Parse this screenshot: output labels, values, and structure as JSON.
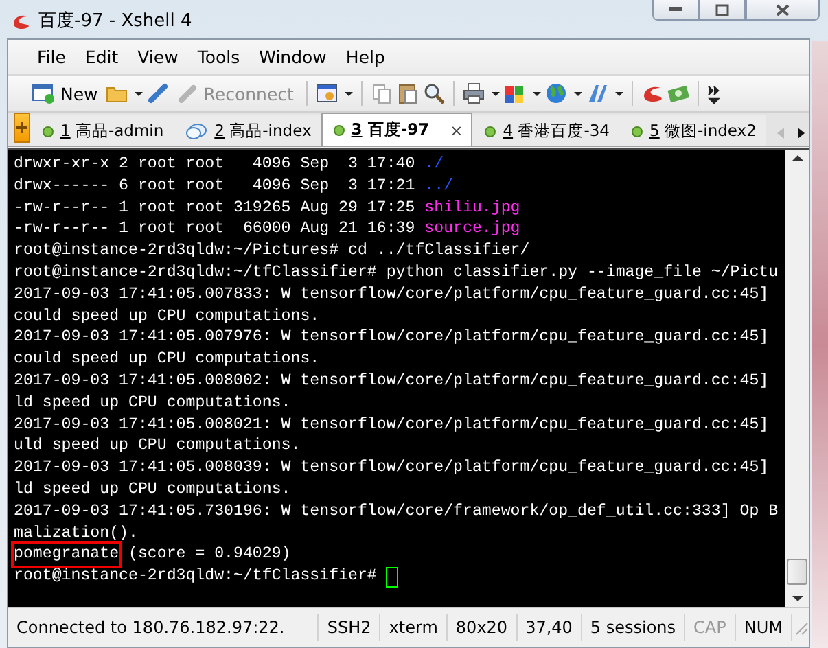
{
  "window": {
    "title": "百度-97 - Xshell 4"
  },
  "menu": [
    "File",
    "Edit",
    "View",
    "Tools",
    "Window",
    "Help"
  ],
  "toolbar": {
    "new": {
      "label": "New",
      "disabled": false
    },
    "reconnect": {
      "label": "Reconnect",
      "disabled": true
    }
  },
  "tabs": [
    {
      "number": "1",
      "label": "高品-admin",
      "kind": "dot",
      "selected": false
    },
    {
      "number": "2",
      "label": "高品-index",
      "kind": "chat",
      "selected": false
    },
    {
      "number": "3",
      "label": "百度-97",
      "kind": "dot",
      "selected": true,
      "close": "×"
    },
    {
      "number": "4",
      "label": "香港百度-34",
      "kind": "dot",
      "selected": false
    },
    {
      "number": "5",
      "label": "微图-index2",
      "kind": "dot",
      "selected": false
    }
  ],
  "terminal": {
    "lines": [
      {
        "segments": [
          {
            "text": "drwxr-xr-x 2 root root   4096 Sep  3 17:40 ",
            "kind": "plain"
          },
          {
            "text": "./",
            "kind": "dir"
          }
        ]
      },
      {
        "segments": [
          {
            "text": "drwx------ 6 root root   4096 Sep  3 17:21 ",
            "kind": "plain"
          },
          {
            "text": "../",
            "kind": "dir"
          }
        ]
      },
      {
        "segments": [
          {
            "text": "-rw-r--r-- 1 root root 319265 Aug 29 17:25 ",
            "kind": "plain"
          },
          {
            "text": "shiliu.jpg",
            "kind": "image"
          }
        ]
      },
      {
        "segments": [
          {
            "text": "-rw-r--r-- 1 root root  66000 Aug 21 16:39 ",
            "kind": "plain"
          },
          {
            "text": "source.jpg",
            "kind": "image"
          }
        ]
      },
      {
        "segments": [
          {
            "text": "root@instance-2rd3qldw:~/Pictures# cd ../tfClassifier/",
            "kind": "plain"
          }
        ]
      },
      {
        "segments": [
          {
            "text": "root@instance-2rd3qldw:~/tfClassifier# python classifier.py --image_file ~/Pictu",
            "kind": "plain"
          }
        ]
      },
      {
        "segments": [
          {
            "text": "2017-09-03 17:41:05.007833: W tensorflow/core/platform/cpu_feature_guard.cc:45]",
            "kind": "plain"
          }
        ]
      },
      {
        "segments": [
          {
            "text": "could speed up CPU computations.",
            "kind": "plain"
          }
        ]
      },
      {
        "segments": [
          {
            "text": "2017-09-03 17:41:05.007976: W tensorflow/core/platform/cpu_feature_guard.cc:45]",
            "kind": "plain"
          }
        ]
      },
      {
        "segments": [
          {
            "text": "could speed up CPU computations.",
            "kind": "plain"
          }
        ]
      },
      {
        "segments": [
          {
            "text": "2017-09-03 17:41:05.008002: W tensorflow/core/platform/cpu_feature_guard.cc:45]",
            "kind": "plain"
          }
        ]
      },
      {
        "segments": [
          {
            "text": "ld speed up CPU computations.",
            "kind": "plain"
          }
        ]
      },
      {
        "segments": [
          {
            "text": "2017-09-03 17:41:05.008021: W tensorflow/core/platform/cpu_feature_guard.cc:45]",
            "kind": "plain"
          }
        ]
      },
      {
        "segments": [
          {
            "text": "uld speed up CPU computations.",
            "kind": "plain"
          }
        ]
      },
      {
        "segments": [
          {
            "text": "2017-09-03 17:41:05.008039: W tensorflow/core/platform/cpu_feature_guard.cc:45]",
            "kind": "plain"
          }
        ]
      },
      {
        "segments": [
          {
            "text": "ld speed up CPU computations.",
            "kind": "plain"
          }
        ]
      },
      {
        "segments": [
          {
            "text": "2017-09-03 17:41:05.730196: W tensorflow/core/framework/op_def_util.cc:333] Op B",
            "kind": "plain"
          }
        ]
      },
      {
        "segments": [
          {
            "text": "malization().",
            "kind": "plain"
          }
        ]
      },
      {
        "segments": [
          {
            "text": "pomegranate",
            "kind": "boxed"
          },
          {
            "text": " (score = 0.94029)",
            "kind": "plain"
          }
        ]
      },
      {
        "segments": [
          {
            "text": "root@instance-2rd3qldw:~/tfClassifier# ",
            "kind": "plain"
          }
        ],
        "cursor": true
      }
    ]
  },
  "status_bar": [
    {
      "text": "Connected to 180.76.182.97:22.",
      "disabled": false
    },
    {
      "text": "SSH2",
      "disabled": false
    },
    {
      "text": "xterm",
      "disabled": false
    },
    {
      "text": "80x20",
      "disabled": false
    },
    {
      "text": "37,40",
      "disabled": false
    },
    {
      "text": "5 sessions",
      "disabled": false
    },
    {
      "text": "CAP",
      "disabled": true
    },
    {
      "text": "NUM",
      "disabled": false
    }
  ]
}
